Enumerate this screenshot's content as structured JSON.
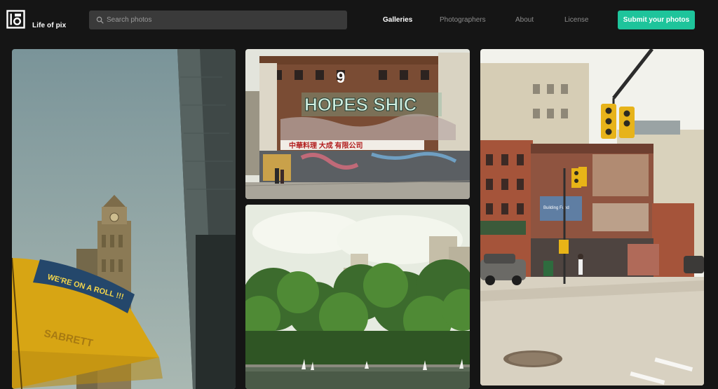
{
  "brand": {
    "name": "Life of pix"
  },
  "search": {
    "placeholder": "Search photos",
    "value": ""
  },
  "nav": {
    "items": [
      {
        "label": "Galleries",
        "active": true
      },
      {
        "label": "Photographers",
        "active": false
      },
      {
        "label": "About",
        "active": false
      },
      {
        "label": "License",
        "active": false
      }
    ],
    "cta_label": "Submit your photos"
  },
  "colors": {
    "background": "#151515",
    "accent": "#1ec49b",
    "search_bg": "#3a3a3a",
    "nav_inactive": "#8c8c8c"
  },
  "photos": [
    {
      "subject": "low-angle view of a clock tower and a yellow street-vendor umbrella",
      "umbrella_text": "WE'RE ON A ROLL !!!",
      "umbrella_brand": "SABRETT"
    },
    {
      "subject": "brick building covered in graffiti above a Chinese restaurant",
      "wall_text": "HOPES  SHIC",
      "number": "9",
      "sign_text": "中華料理 大成 有限公司"
    },
    {
      "subject": "park pond with toy sailboats, trees and tall buildings"
    },
    {
      "subject": "street corner with red brick buildings and yellow traffic lights",
      "sign_text": "Building Fund"
    }
  ]
}
